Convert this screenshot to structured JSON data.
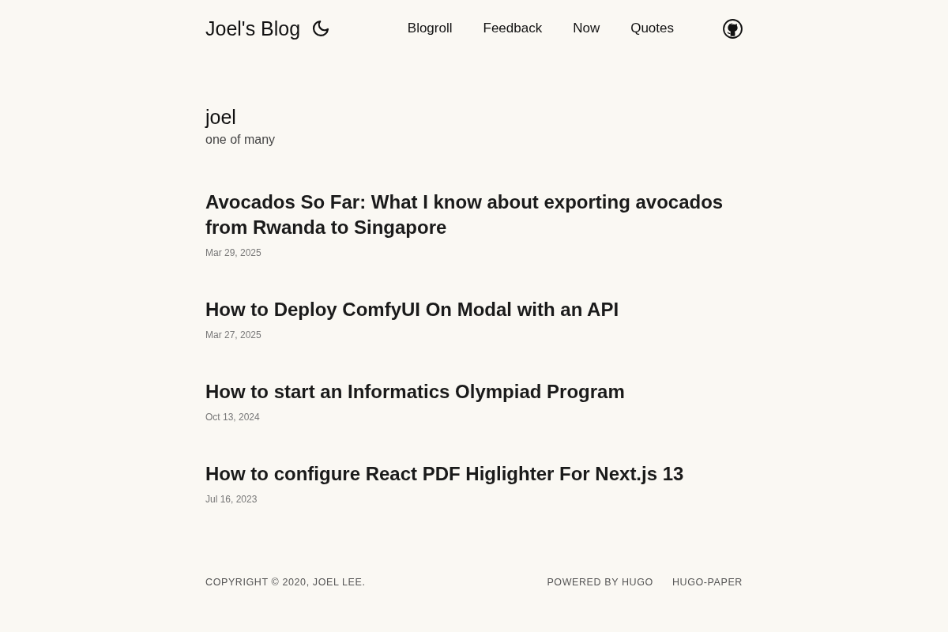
{
  "header": {
    "site_title": "Joel's Blog",
    "nav": [
      "Blogroll",
      "Feedback",
      "Now",
      "Quotes"
    ]
  },
  "profile": {
    "name": "joel",
    "tagline": "one of many"
  },
  "posts": [
    {
      "title": "Avocados So Far: What I know about exporting avocados from Rwanda to Singapore",
      "date": "Mar 29, 2025"
    },
    {
      "title": "How to Deploy ComfyUI On Modal with an API",
      "date": "Mar 27, 2025"
    },
    {
      "title": "How to start an Informatics Olympiad Program",
      "date": "Oct 13, 2024"
    },
    {
      "title": "How to configure React PDF Higlighter For Next.js 13",
      "date": "Jul 16, 2023"
    }
  ],
  "footer": {
    "copyright": "COPYRIGHT © 2020, JOEL LEE.",
    "links": [
      "POWERED BY HUGO",
      "HUGO-PAPER"
    ]
  }
}
